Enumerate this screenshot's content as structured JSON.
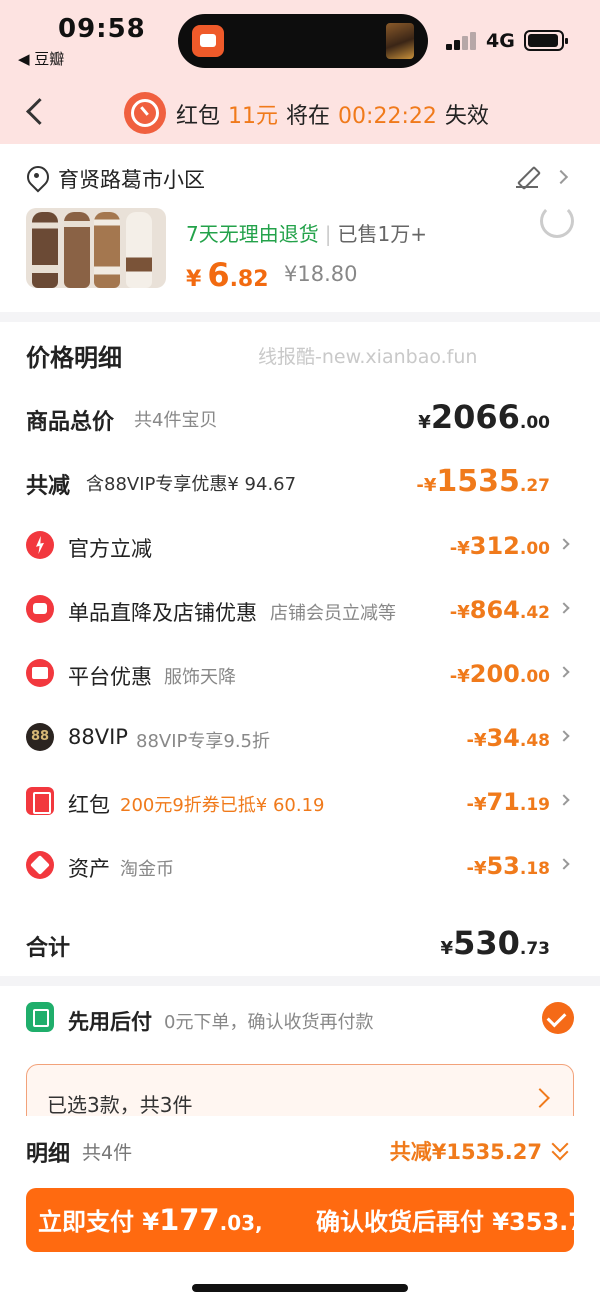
{
  "status_bar": {
    "time": "09:58",
    "back_app": "◀ 豆瓣",
    "network": "4G"
  },
  "header": {
    "prefix": "红包",
    "amount": "11元",
    "middle": "将在",
    "countdown": [
      "00",
      "22",
      "22"
    ],
    "suffix": "失效"
  },
  "address": {
    "text": "育贤路葛市小区"
  },
  "product": {
    "tag_return": "7天无理由退货",
    "tag_sold": "已售1万+",
    "price_currency": "¥",
    "price_int": "6",
    "price_dec": ".82",
    "price_original": "¥18.80"
  },
  "breakdown": {
    "title": "价格明细",
    "watermark": "线报酷-new.xianbao.fun",
    "goods_total": {
      "label": "商品总价",
      "note": "共4件宝贝",
      "currency": "¥",
      "int": "2066",
      "dec": ".00"
    },
    "total_reduce": {
      "label": "共减",
      "note": "含88VIP专享优惠¥ 94.67",
      "prefix": "-¥",
      "int": "1535",
      "dec": ".27"
    },
    "items": [
      {
        "icon": "flash-icon",
        "label": "官方立减",
        "note": "",
        "prefix": "-¥",
        "int": "312",
        "dec": ".00"
      },
      {
        "icon": "shop-icon",
        "label": "单品直降及店铺优惠",
        "note": "店铺会员立减等",
        "prefix": "-¥",
        "int": "864",
        "dec": ".42"
      },
      {
        "icon": "platform-coupon-icon",
        "label": "平台优惠",
        "note": "服饰天降",
        "prefix": "-¥",
        "int": "200",
        "dec": ".00"
      },
      {
        "icon": "88vip-icon",
        "label": "88VIP",
        "note": "88VIP专享9.5折",
        "prefix": "-¥",
        "int": "34",
        "dec": ".48"
      },
      {
        "icon": "red-packet-icon",
        "label": "红包",
        "note": "200元9折券已抵¥ 60.19",
        "prefix": "-¥",
        "int": "71",
        "dec": ".19"
      },
      {
        "icon": "asset-icon",
        "label": "资产",
        "note": "淘金币",
        "prefix": "-¥",
        "int": "53",
        "dec": ".18"
      }
    ],
    "sum": {
      "label": "合计",
      "currency": "¥",
      "int": "530",
      "dec": ".73"
    }
  },
  "pay_later": {
    "label": "先用后付",
    "note": "0元下单，确认收货再付款"
  },
  "selected": {
    "text": "已选3款，共3件"
  },
  "detail": {
    "title": "明细",
    "count": "共4件",
    "total": "共减¥1535.27"
  },
  "pay_button": {
    "left_prefix": "立即支付 ¥",
    "left_int": "177",
    "left_dec": ".03,",
    "right_text": "确认收货后再付 ¥353.7"
  },
  "colors": {
    "accent": "#f07a1b",
    "button": "#ff6a10",
    "header_bg": "#fde3e1",
    "green": "#23a24a"
  }
}
